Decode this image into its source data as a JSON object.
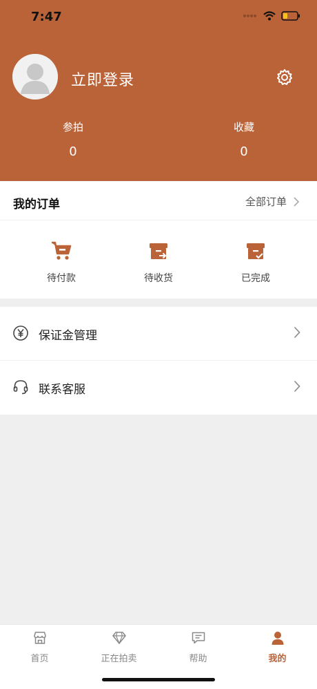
{
  "status_bar": {
    "time": "7:47"
  },
  "profile": {
    "login_text": "立即登录"
  },
  "stats": [
    {
      "label": "参拍",
      "value": "0"
    },
    {
      "label": "收藏",
      "value": "0"
    }
  ],
  "orders": {
    "title": "我的订单",
    "all_label": "全部订单",
    "items": [
      {
        "label": "待付款",
        "icon": "cart-icon"
      },
      {
        "label": "待收货",
        "icon": "package-arrow-icon"
      },
      {
        "label": "已完成",
        "icon": "package-check-icon"
      }
    ]
  },
  "menu": [
    {
      "label": "保证金管理",
      "icon": "yen-icon"
    },
    {
      "label": "联系客服",
      "icon": "headset-icon"
    }
  ],
  "tabs": [
    {
      "label": "首页",
      "icon": "store-icon",
      "active": false
    },
    {
      "label": "正在拍卖",
      "icon": "diamond-icon",
      "active": false
    },
    {
      "label": "帮助",
      "icon": "chat-icon",
      "active": false
    },
    {
      "label": "我的",
      "icon": "person-icon",
      "active": true
    }
  ],
  "colors": {
    "accent": "#bb6338",
    "background": "#efefef"
  }
}
